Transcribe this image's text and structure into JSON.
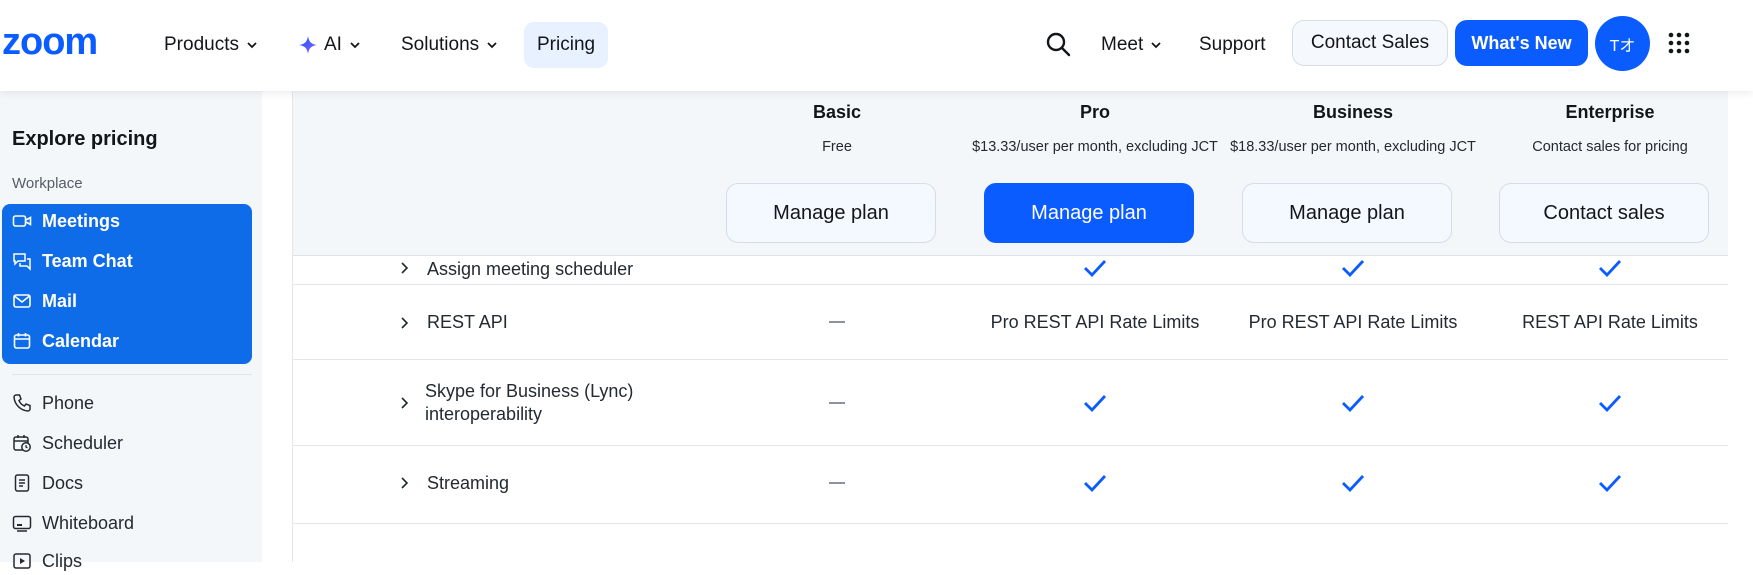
{
  "nav": {
    "logo": "zoom",
    "products": "Products",
    "ai": "AI",
    "solutions": "Solutions",
    "pricing": "Pricing",
    "meet": "Meet",
    "support": "Support",
    "contact_sales": "Contact Sales",
    "whats_new": "What's New",
    "avatar": "Tオ",
    "icons": [
      "search-icon",
      "grid-icon",
      "chevron-down-icon",
      "ai-star-icon"
    ],
    "brand_color": "#0b5cff"
  },
  "sidebar": {
    "title": "Explore pricing",
    "section": "Workplace",
    "selected_group": [
      {
        "label": "Meetings",
        "icon": "video-icon"
      },
      {
        "label": "Team Chat",
        "icon": "chat-icon"
      },
      {
        "label": "Mail",
        "icon": "mail-icon"
      },
      {
        "label": "Calendar",
        "icon": "calendar-icon"
      }
    ],
    "items": [
      {
        "label": "Phone",
        "icon": "phone-icon"
      },
      {
        "label": "Scheduler",
        "icon": "scheduler-icon"
      },
      {
        "label": "Docs",
        "icon": "docs-icon"
      },
      {
        "label": "Whiteboard",
        "icon": "whiteboard-icon"
      },
      {
        "label": "Clips",
        "icon": "clips-icon"
      }
    ],
    "group_color": "#0e6ce8"
  },
  "plans": [
    {
      "name": "Basic",
      "price": "Free",
      "button": "Manage plan",
      "primary": false
    },
    {
      "name": "Pro",
      "price": "$13.33/user per month, excluding JCT",
      "button": "Manage plan",
      "primary": true
    },
    {
      "name": "Business",
      "price": "$18.33/user per month, excluding JCT",
      "button": "Manage plan",
      "primary": false
    },
    {
      "name": "Enterprise",
      "price": "Contact sales for pricing",
      "button": "Contact sales",
      "primary": false
    }
  ],
  "rows": [
    {
      "label": "Assign meeting scheduler",
      "values": [
        "",
        "check",
        "check",
        "check"
      ]
    },
    {
      "label": "REST API",
      "values": [
        "dash",
        "Pro REST API Rate Limits",
        "Pro REST API Rate Limits",
        "REST API Rate Limits"
      ]
    },
    {
      "label": "Skype for Business (Lync) interoperability",
      "values": [
        "dash",
        "check",
        "check",
        "check"
      ]
    },
    {
      "label": "Streaming",
      "values": [
        "dash",
        "check",
        "check",
        "check"
      ]
    }
  ]
}
